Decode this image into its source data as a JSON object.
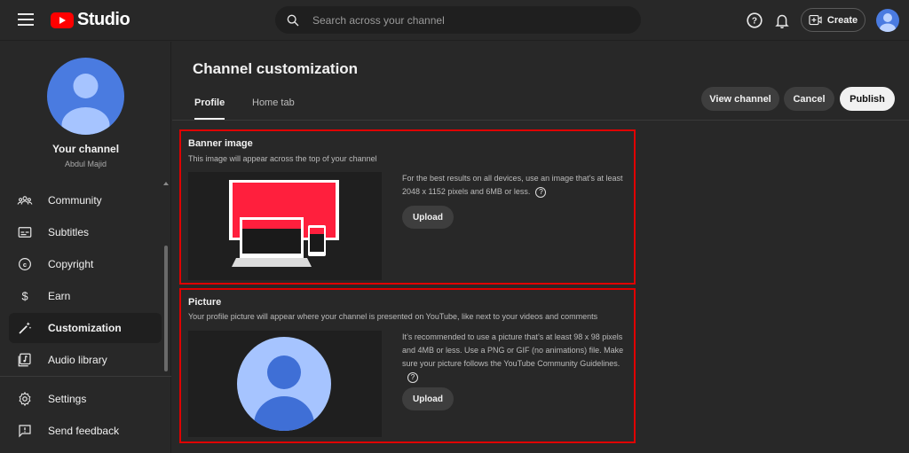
{
  "app": {
    "logo_text": "Studio"
  },
  "search": {
    "placeholder": "Search across your channel"
  },
  "header": {
    "create_label": "Create"
  },
  "sidebar": {
    "channel_title": "Your channel",
    "channel_name": "Abdul Majid",
    "items": [
      {
        "label": "Community",
        "icon": "community-icon"
      },
      {
        "label": "Subtitles",
        "icon": "subtitles-icon"
      },
      {
        "label": "Copyright",
        "icon": "copyright-icon"
      },
      {
        "label": "Earn",
        "icon": "dollar-icon"
      },
      {
        "label": "Customization",
        "icon": "magic-wand-icon",
        "active": true
      },
      {
        "label": "Audio library",
        "icon": "audio-library-icon"
      }
    ],
    "bottom_items": [
      {
        "label": "Settings",
        "icon": "gear-icon"
      },
      {
        "label": "Send feedback",
        "icon": "feedback-icon"
      }
    ]
  },
  "main": {
    "title": "Channel customization",
    "tabs": [
      {
        "label": "Profile",
        "active": true
      },
      {
        "label": "Home tab",
        "active": false
      }
    ],
    "actions": {
      "view_channel": "View channel",
      "cancel": "Cancel",
      "publish": "Publish"
    },
    "banner": {
      "title": "Banner image",
      "description": "This image will appear across the top of your channel",
      "info": "For the best results on all devices, use an image that’s at least 2048 x 1152 pixels and 6MB or less.",
      "upload_label": "Upload"
    },
    "picture": {
      "title": "Picture",
      "description": "Your profile picture will appear where your channel is presented on YouTube, like next to your videos and comments",
      "info": "It’s recommended to use a picture that’s at least 98 x 98 pixels and 4MB or less. Use a PNG or GIF (no animations) file. Make sure your picture follows the YouTube Community Guidelines.",
      "upload_label": "Upload"
    }
  },
  "colors": {
    "background": "#282828",
    "highlight_border": "#e00000",
    "avatar_blue": "#4a7be0",
    "brand_red": "#ff0000"
  }
}
